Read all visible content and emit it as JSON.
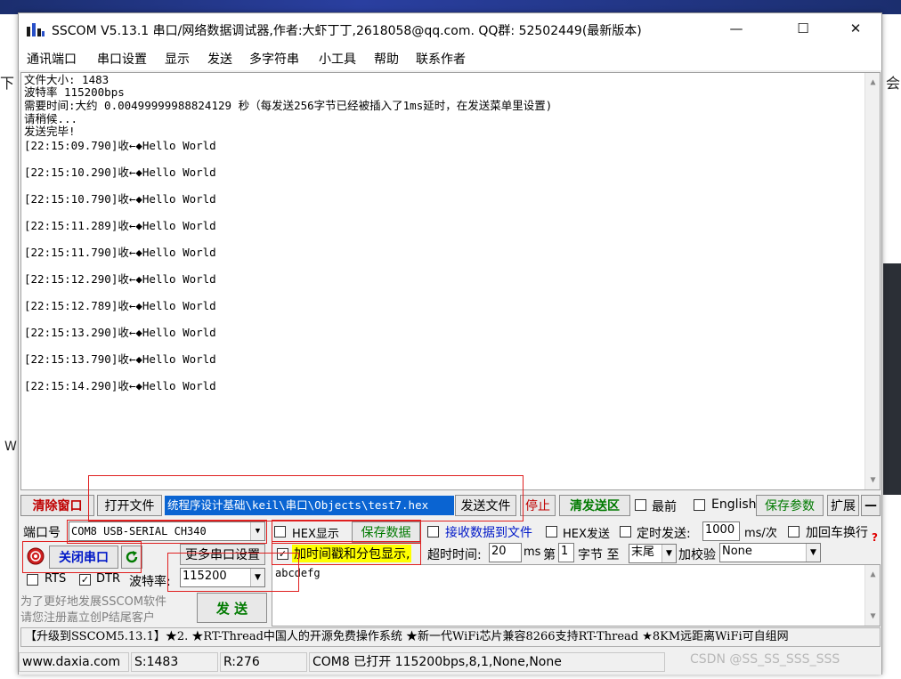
{
  "window": {
    "title": "SSCOM V5.13.1 串口/网络数据调试器,作者:大虾丁丁,2618058@qq.com. QQ群: 52502449(最新版本)",
    "minimize": "—",
    "maximize": "☐",
    "close": "✕"
  },
  "menu": [
    "通讯端口",
    "串口设置",
    "显示",
    "发送",
    "多字符串",
    "小工具",
    "帮助",
    "联系作者"
  ],
  "receive": {
    "header_lines": [
      "文件大小: 1483",
      "波特率 115200bps",
      "需要时间:大约 0.00499999988824129 秒（每发送256字节已经被插入了1ms延时，在发送菜单里设置)",
      "请稍候...",
      "发送完毕!"
    ],
    "log_lines": [
      "[22:15:09.790]收←◆Hello World",
      "[22:15:10.290]收←◆Hello World",
      "[22:15:10.790]收←◆Hello World",
      "[22:15:11.289]收←◆Hello World",
      "[22:15:11.790]收←◆Hello World",
      "[22:15:12.290]收←◆Hello World",
      "[22:15:12.789]收←◆Hello World",
      "[22:15:13.290]收←◆Hello World",
      "[22:15:13.790]收←◆Hello World",
      "[22:15:14.290]收←◆Hello World"
    ]
  },
  "toolbar": {
    "clear_window": "清除窗口",
    "open_file": "打开文件",
    "file_path": "统程序设计基础\\keil\\串口\\Objects\\test7.hex",
    "send_file": "发送文件",
    "stop": "停止",
    "clear_send": "清发送区",
    "topmost": "最前",
    "english": "English",
    "save_params": "保存参数",
    "expand": "扩展",
    "collapse": "—"
  },
  "port_row": {
    "port_label": "端口号",
    "port_value": "COM8 USB-SERIAL CH340",
    "hex_display": "HEX显示",
    "save_data": "保存数据",
    "recv_to_file": "接收数据到文件",
    "hex_send": "HEX发送",
    "timed_send": "定时发送:",
    "interval": "1000",
    "interval_unit": "ms/次",
    "add_newline": "加回车换行"
  },
  "open_row": {
    "close_port": "关闭串口",
    "more_settings": "更多串口设置",
    "timestamp": "加时间戳和分包显示,",
    "timeout_label": "超时时间:",
    "timeout_value": "20",
    "timeout_unit": "ms",
    "page_label": "第",
    "page_value": "1",
    "byte_label": "字节 至",
    "tail_value": "末尾",
    "checksum_label": "加校验",
    "checksum_value": "None"
  },
  "signal_row": {
    "rts": "RTS",
    "dtr": "DTR",
    "baud_label": "波特率:",
    "baud_value": "115200"
  },
  "send": {
    "text": "abcdefg",
    "button": "发 送",
    "hint_line1": "为了更好地发展SSCOM软件",
    "hint_line2": "请您注册嘉立创P结尾客户"
  },
  "ad": "【升级到SSCOM5.13.1】★2. ★RT-Thread中国人的开源免费操作系统 ★新一代WiFi芯片兼容8266支持RT-Thread ★8KM远距离WiFi可自组网",
  "status": {
    "site": "www.daxia.com",
    "sent": "S:1483",
    "received": "R:276",
    "port_status": "COM8 已打开  115200bps,8,1,None,None"
  },
  "watermark": "CSDN @SS_SS_SSS_SSS",
  "background": {
    "left_glyph": "下",
    "right_glyph": "会",
    "left_w": "W"
  }
}
